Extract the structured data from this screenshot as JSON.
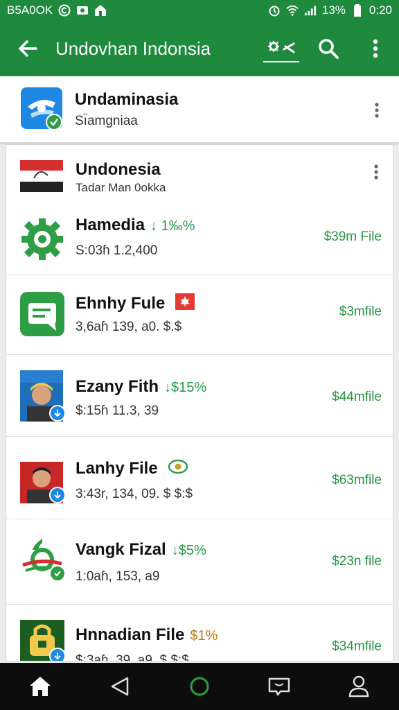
{
  "status_bar": {
    "left_text": "B5A0OK",
    "battery": "13%",
    "time": "0:20"
  },
  "app_bar": {
    "title": "Undovhan Indonsia"
  },
  "top_item": {
    "name": "Undaminasia",
    "subtitle": "Sı̈amgniaa"
  },
  "group_header": {
    "name": "Undonesia",
    "subtitle": "Tadar Man 0okka"
  },
  "rows": [
    {
      "name": "Hamedia",
      "delta": "↓ 1‰%",
      "sub": "S:03ɦ 1.2,400",
      "amount": "$39m File"
    },
    {
      "name": "Ehnhy Fule",
      "delta": "",
      "sub": "3,6aɦ 139, a0. $.$",
      "amount": "$3mfile"
    },
    {
      "name": "Ezany Fith",
      "delta": "↓$15%",
      "sub": "$:15ɦ 11.3, 39",
      "amount": "$44mfile"
    },
    {
      "name": "Lanhy File",
      "delta": "",
      "sub": "3:43r, 134, 09. $ $:$",
      "amount": "$63mfile"
    },
    {
      "name": "Vangk Fizal",
      "delta": "↓$5%",
      "sub": "1:0aɦ, 153, a9",
      "amount": "$23n file"
    },
    {
      "name": "Hnnadian File",
      "delta": "$1%",
      "sub": "$:3aɦ. 39, a9. $ $:$",
      "amount": "$34mfile"
    }
  ],
  "colors": {
    "primary": "#1f8a3e",
    "accent_green": "#23963f",
    "orange": "#c9770e",
    "red": "#d93025"
  }
}
